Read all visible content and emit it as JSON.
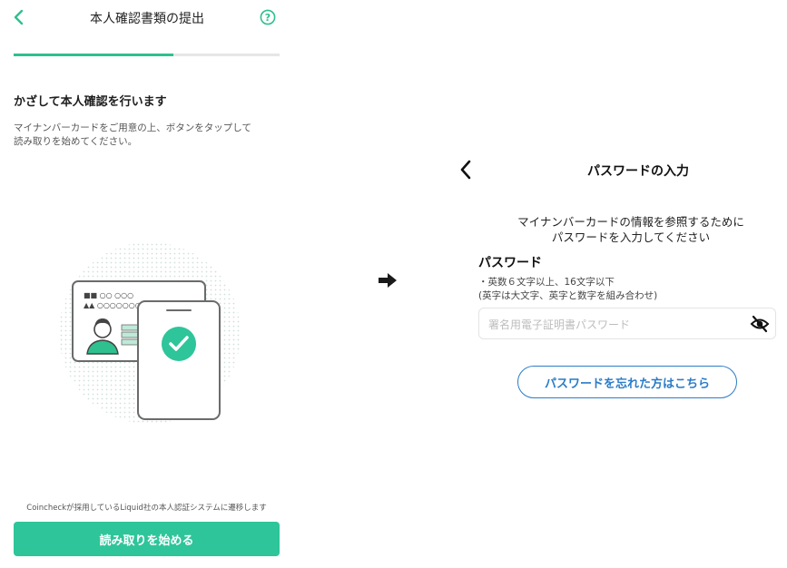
{
  "left_screen": {
    "title": "本人確認書類の提出",
    "progress_fraction": 0.6,
    "heading": "かざして本人確認を行います",
    "description_line1": "マイナンバーカードをご用意の上、ボタンをタップして",
    "description_line2": "読み取りを始めてください。",
    "card_text_line1": "■■ ○○ ○○○",
    "card_text_line2": "▲▲ ○○○○○○○○",
    "footnote": "Coincheckが採用しているLiquid社の本人認証システムに遷移します",
    "start_button_label": "読み取りを始める",
    "icons": {
      "back": "chevron-left-icon",
      "help": "question-circle-icon"
    }
  },
  "right_screen": {
    "title": "パスワードの入力",
    "info_line1": "マイナンバーカードの情報を参照するために",
    "info_line2": "パスワードを入力してください",
    "password_label": "パスワード",
    "rule_line1": "・英数６文字以上、16文字以下",
    "rule_line2": "(英字は大文字、英字と数字を組み合わせ)",
    "password_placeholder": "署名用電子証明書パスワード",
    "password_value": "",
    "forgot_button_label": "パスワードを忘れた方はこちら",
    "icons": {
      "back": "chevron-left-icon",
      "visibility": "eye-off-icon"
    }
  },
  "colors": {
    "accent_green": "#2ec59a",
    "progress_green": "#2ec08e",
    "link_blue": "#2b7cc7",
    "placeholder_gray": "#bdbdbd"
  }
}
